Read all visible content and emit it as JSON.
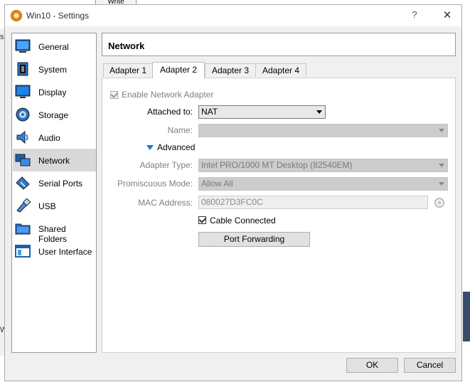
{
  "window": {
    "title": "Win10 - Settings",
    "help_glyph": "?",
    "close_glyph": "✕"
  },
  "background": {
    "write_tab": "Write",
    "left_fragment": "se",
    "left_fragment2": "W"
  },
  "sidebar": {
    "items": [
      {
        "label": "General",
        "icon": "general-icon"
      },
      {
        "label": "System",
        "icon": "system-icon"
      },
      {
        "label": "Display",
        "icon": "display-icon"
      },
      {
        "label": "Storage",
        "icon": "storage-icon"
      },
      {
        "label": "Audio",
        "icon": "audio-icon"
      },
      {
        "label": "Network",
        "icon": "network-icon",
        "selected": true
      },
      {
        "label": "Serial Ports",
        "icon": "serial-ports-icon"
      },
      {
        "label": "USB",
        "icon": "usb-icon"
      },
      {
        "label": "Shared Folders",
        "icon": "shared-folders-icon"
      },
      {
        "label": "User Interface",
        "icon": "user-interface-icon"
      }
    ]
  },
  "header": {
    "title": "Network"
  },
  "tabs": [
    {
      "label": "Adapter 1"
    },
    {
      "label": "Adapter 2",
      "active": true
    },
    {
      "label": "Adapter 3"
    },
    {
      "label": "Adapter 4"
    }
  ],
  "adapter": {
    "enable_label": "Enable Network Adapter",
    "enable_checked": true,
    "attached_label": "Attached to:",
    "attached_value": "NAT",
    "name_label": "Name:",
    "name_value": "",
    "advanced_label": "Advanced",
    "adapter_type_label": "Adapter Type:",
    "adapter_type_value": "Intel PRO/1000 MT Desktop (82540EM)",
    "promiscuous_label": "Promiscuous Mode:",
    "promiscuous_value": "Allow All",
    "mac_label": "MAC Address:",
    "mac_value": "080027D3FC0C",
    "cable_label": "Cable Connected",
    "cable_checked": true,
    "port_forwarding_label": "Port Forwarding"
  },
  "footer": {
    "ok_label": "OK",
    "cancel_label": "Cancel"
  }
}
